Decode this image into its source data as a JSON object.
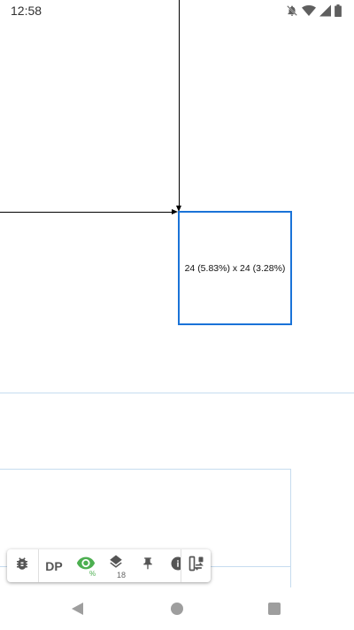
{
  "status_bar": {
    "time": "12:58",
    "icons": [
      "notifications-off-icon",
      "wifi-icon",
      "signal-icon",
      "battery-icon"
    ]
  },
  "measurement": {
    "label": "24 (5.83%) x 24 (3.28%)",
    "box_color": "#1a73d8",
    "guide_color": "#000000"
  },
  "outline_color": "#c6dcef",
  "toolbar": {
    "tools": [
      {
        "name": "bug-icon"
      },
      {
        "name": "dp-unit-toggle",
        "label": "DP"
      },
      {
        "name": "eye-icon",
        "badge": "%"
      },
      {
        "name": "layers-icon",
        "badge": "18"
      },
      {
        "name": "pin-icon"
      },
      {
        "name": "info-icon"
      },
      {
        "name": "swap-layout-icon"
      }
    ],
    "accent": "#4caf50"
  },
  "nav_bar": {
    "buttons": [
      "back-button",
      "home-button",
      "recents-button"
    ]
  }
}
